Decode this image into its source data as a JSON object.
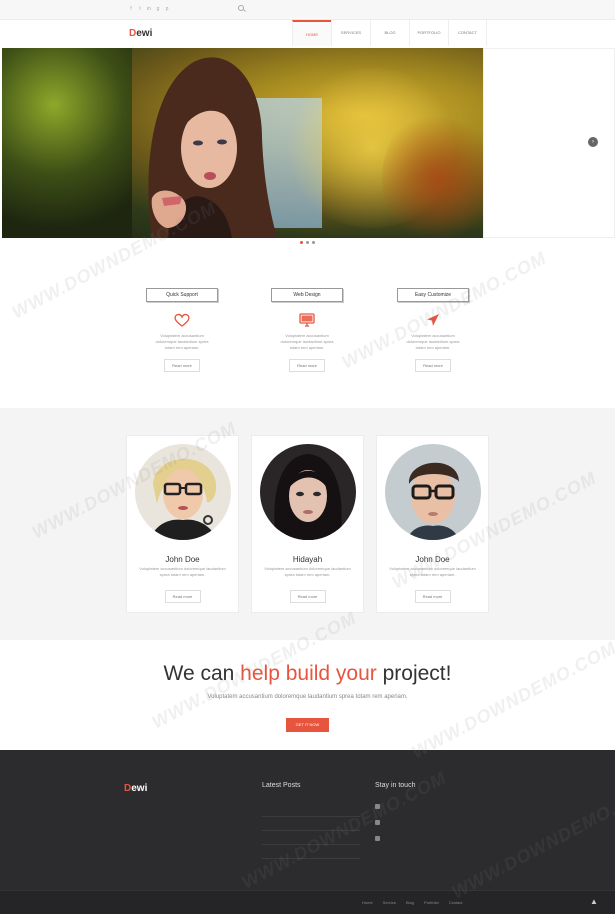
{
  "topbar": {
    "social_icons": [
      "f",
      "t",
      "in",
      "g",
      "p"
    ],
    "search_icon": "search-icon"
  },
  "nav": {
    "logo_first": "D",
    "logo_rest": "ewi",
    "items": [
      "HOME",
      "SERVICES",
      "BLOG",
      "PORTFOLIO",
      "CONTACT"
    ],
    "active_index": 0
  },
  "slider": {
    "next_icon": "›",
    "dots_count": 3,
    "active_dot": 0
  },
  "features": [
    {
      "title": "Quick Support",
      "icon": "heart-icon",
      "text": "Voluptatem accusantium doloremque laudantium sprea totam rem aperiam.",
      "button": "Read more"
    },
    {
      "title": "Web Design",
      "icon": "monitor-icon",
      "text": "Voluptatem accusantium doloremque laudantium sprea totam rem aperiam.",
      "button": "Read more"
    },
    {
      "title": "Easy Customize",
      "icon": "send-icon",
      "text": "Voluptatem accusantium doloremque laudantium sprea totam rem aperiam.",
      "button": "Read more"
    }
  ],
  "team": [
    {
      "name": "John Doe",
      "text": "Voluptatem accusantium doloremque laudantium sprea totam rem aperiam.",
      "button": "Read more"
    },
    {
      "name": "Hidayah",
      "text": "Voluptatem accusantium doloremque laudantium sprea totam rem aperiam.",
      "button": "Read more"
    },
    {
      "name": "John Doe",
      "text": "Voluptatem accusantium doloremque laudantium sprea totam rem aperiam.",
      "button": "Read more"
    }
  ],
  "cta": {
    "title_1": "We can ",
    "title_highlight": "help build your",
    "title_2": " project!",
    "subtitle": "Voluptatem accusantium doloremque laudantium sprea totam rem aperiam.",
    "button": "GET IT NOW"
  },
  "footer": {
    "logo_first": "D",
    "logo_rest": "ewi",
    "latest_posts_title": "Latest Posts",
    "stay_title": "Stay in touch",
    "nav": [
      "Home",
      "Service",
      "Blog",
      "Portfolio",
      "Contact"
    ]
  },
  "colors": {
    "accent": "#e8553e",
    "footer_bg": "#2c2c2e",
    "team_bg": "#f4f4f4"
  },
  "watermark_text": "WWW.DOWNDEMO.COM"
}
